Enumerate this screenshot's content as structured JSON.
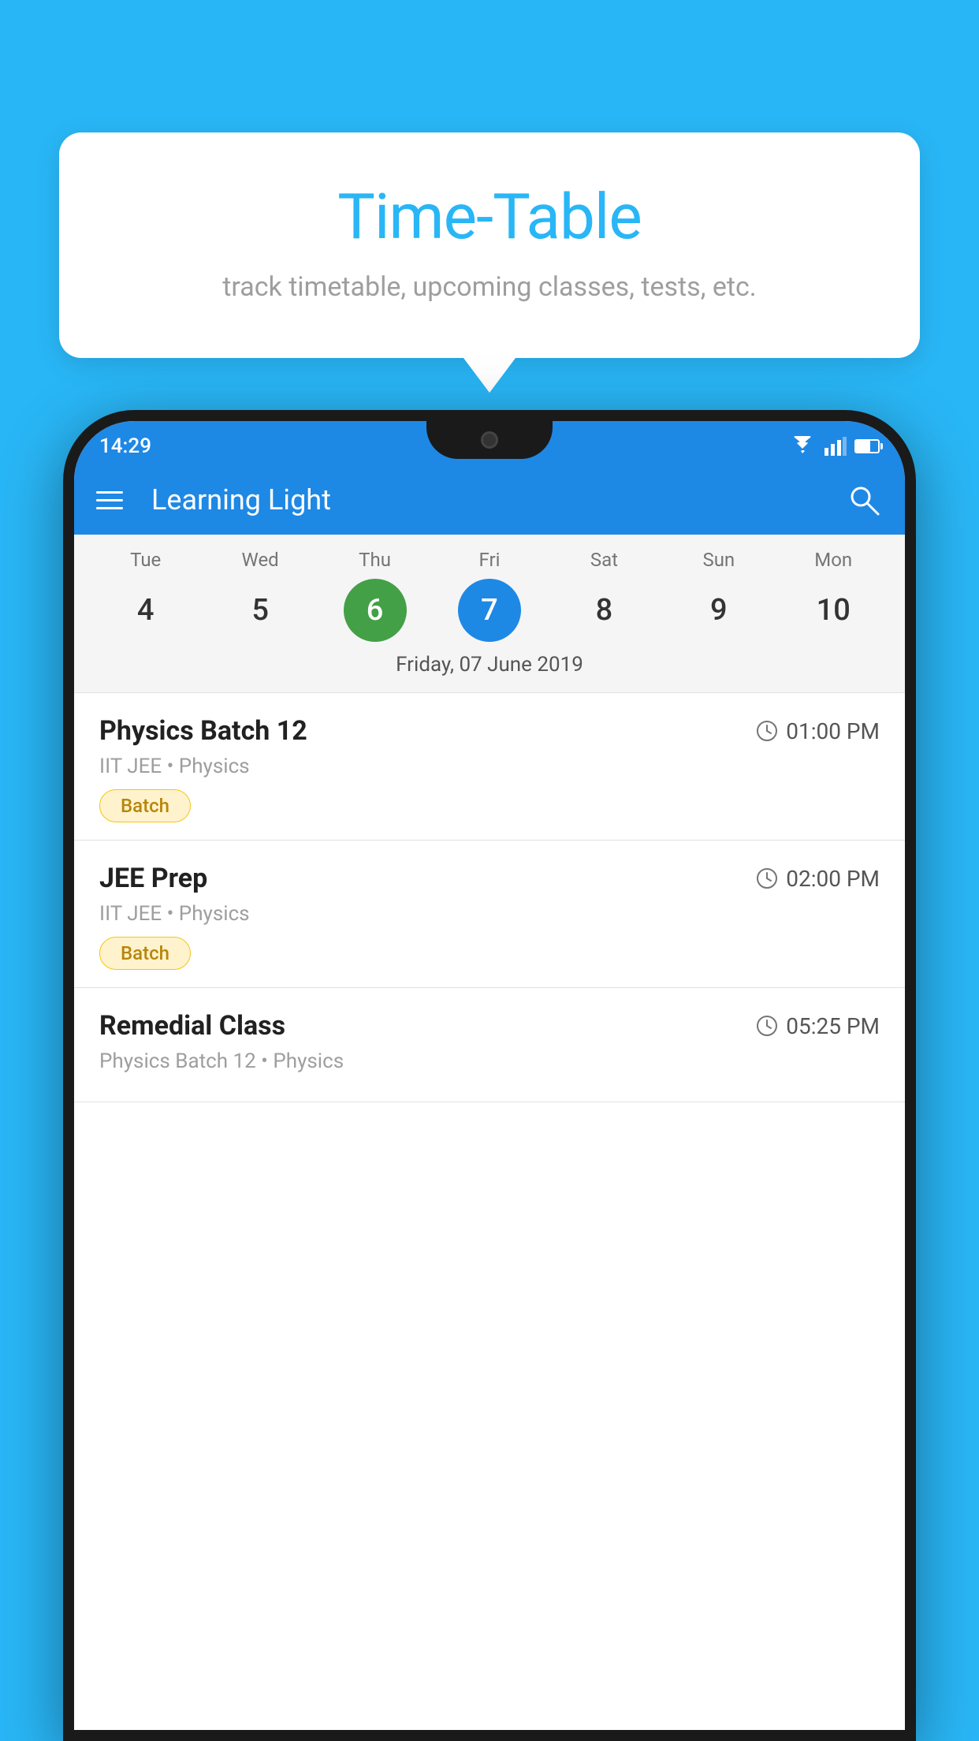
{
  "background_color": "#29B6F6",
  "tooltip": {
    "title": "Time-Table",
    "subtitle": "track timetable, upcoming classes, tests, etc."
  },
  "phone": {
    "status_bar": {
      "time": "14:29"
    },
    "app_bar": {
      "title": "Learning Light"
    },
    "calendar": {
      "days": [
        {
          "label": "Tue",
          "num": "4"
        },
        {
          "label": "Wed",
          "num": "5"
        },
        {
          "label": "Thu",
          "num": "6",
          "state": "today"
        },
        {
          "label": "Fri",
          "num": "7",
          "state": "selected"
        },
        {
          "label": "Sat",
          "num": "8"
        },
        {
          "label": "Sun",
          "num": "9"
        },
        {
          "label": "Mon",
          "num": "10"
        }
      ],
      "selected_date": "Friday, 07 June 2019"
    },
    "schedule": [
      {
        "title": "Physics Batch 12",
        "time": "01:00 PM",
        "subtitle": "IIT JEE • Physics",
        "badge": "Batch"
      },
      {
        "title": "JEE Prep",
        "time": "02:00 PM",
        "subtitle": "IIT JEE • Physics",
        "badge": "Batch"
      },
      {
        "title": "Remedial Class",
        "time": "05:25 PM",
        "subtitle": "Physics Batch 12 • Physics",
        "badge": null
      }
    ]
  }
}
